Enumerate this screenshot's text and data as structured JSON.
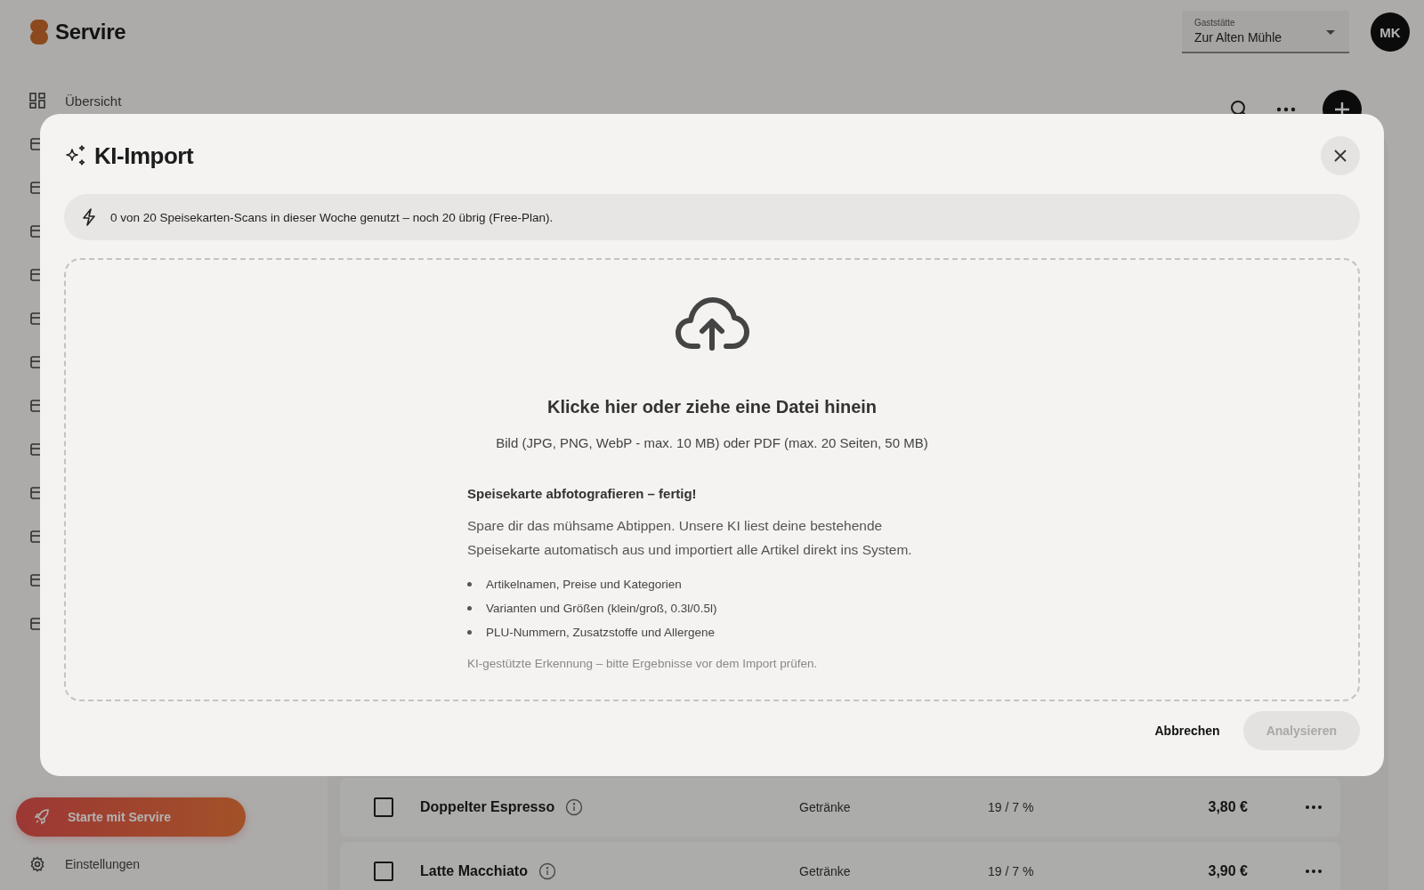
{
  "header": {
    "brand": "Servire",
    "venue_select": {
      "label": "Gaststätte",
      "value": "Zur Alten Mühle"
    },
    "avatar": "MK"
  },
  "sidebar": {
    "items": [
      {
        "label": "Übersicht",
        "selected": false
      }
    ],
    "cta": "Starte mit Servire",
    "settings": "Einstellungen"
  },
  "table": {
    "rows": [
      {
        "checked": false,
        "name": "Doppelter Espresso",
        "category": "Getränke",
        "tax": "19 / 7 %",
        "price": "3,80 €"
      },
      {
        "checked": false,
        "name": "Latte Macchiato",
        "category": "Getränke",
        "tax": "19 / 7 %",
        "price": "3,90 €"
      }
    ]
  },
  "dialog": {
    "title": "KI-Import",
    "usage_notice": "0 von 20 Speisekarten-Scans in dieser Woche genutzt – noch 20 übrig (Free-Plan).",
    "dropzone": {
      "heading": "Klicke hier oder ziehe eine Datei hinein",
      "formats": "Bild (JPG, PNG, WebP - max. 10 MB) oder PDF (max. 20 Seiten, 50 MB)",
      "info_title": "Speisekarte abfotografieren – fertig!",
      "info_text": "Spare dir das mühsame Abtippen. Unsere KI liest deine bestehende Speisekarte automatisch aus und importiert alle Artikel direkt ins System.",
      "features": [
        "Artikelnamen, Preise und Kategorien",
        "Varianten und Größen (klein/groß, 0.3l/0.5l)",
        "PLU-Nummern, Zusatzstoffe und Allergene"
      ],
      "disclaimer": "KI-gestützte Erkennung – bitte Ergebnisse vor dem Import prüfen."
    },
    "buttons": [
      {
        "label": "Abbrechen",
        "disabled": false
      },
      {
        "label": "Analysieren",
        "disabled": true
      }
    ]
  }
}
